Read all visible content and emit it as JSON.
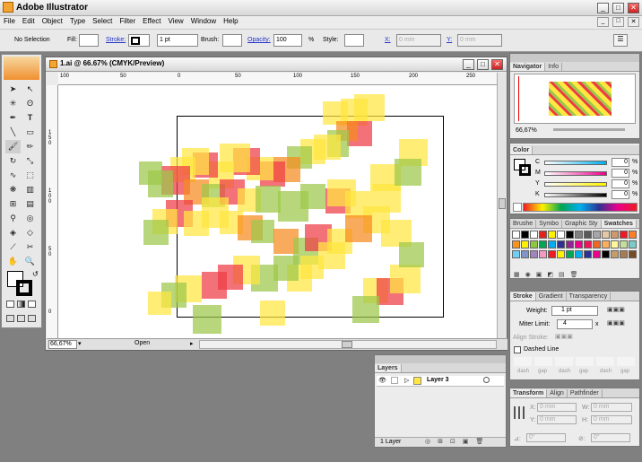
{
  "app": {
    "title": "Adobe Illustrator"
  },
  "menu": [
    "File",
    "Edit",
    "Object",
    "Type",
    "Select",
    "Filter",
    "Effect",
    "View",
    "Window",
    "Help"
  ],
  "control": {
    "selection": "No Selection",
    "fill_label": "Fill:",
    "stroke_label": "Stroke:",
    "stroke_weight": "1 pt",
    "brush_label": "Brush:",
    "opacity_label": "Opacity:",
    "opacity_value": "100",
    "opacity_unit": "%",
    "style_label": "Style:",
    "x_label": "X:",
    "x_value": "0 mm",
    "y_label": "Y:",
    "y_value": "0 mm"
  },
  "document": {
    "title": "1.ai @ 66.67% (CMYK/Preview)",
    "zoom": "66,67%",
    "status": "Open",
    "hruler": [
      "100",
      "50",
      "0",
      "50",
      "100",
      "150",
      "200",
      "250"
    ],
    "vruler": [
      "1\n5\n0",
      "1\n0\n0",
      "5\n0",
      "0"
    ]
  },
  "navigator": {
    "tabs": [
      "Navigator",
      "Info"
    ],
    "zoom": "66,67%"
  },
  "color": {
    "tab": "Color",
    "channels": [
      {
        "label": "C",
        "value": "0",
        "unit": "%"
      },
      {
        "label": "M",
        "value": "0",
        "unit": "%"
      },
      {
        "label": "Y",
        "value": "0",
        "unit": "%"
      },
      {
        "label": "K",
        "value": "0",
        "unit": "%"
      }
    ]
  },
  "swatches": {
    "tabs": [
      "Brushe",
      "Symbo",
      "Graphic Sty",
      "Swatches"
    ],
    "colors": [
      "#ffffff",
      "#000000",
      "#ffffff",
      "#e2231a",
      "#fff200",
      "#ffffff",
      "#000000",
      "#808080",
      "#595959",
      "#a6a6a6",
      "#e5c7a6",
      "#ce9a6a",
      "#ed1c24",
      "#ff7f27",
      "#f7941d",
      "#fff200",
      "#8dc63f",
      "#00a651",
      "#00aeef",
      "#2e3192",
      "#92278f",
      "#ec008c",
      "#ed145b",
      "#f26522",
      "#fbaf5d",
      "#fff799",
      "#c4df9b",
      "#7accc8",
      "#6dcff6",
      "#8393ca",
      "#a186be",
      "#f49ac2",
      "#ed1c24",
      "#fff200",
      "#00a651",
      "#00aeef",
      "#2e3192",
      "#ec008c",
      "#000000",
      "#c69c6d",
      "#a67c52",
      "#754c24"
    ]
  },
  "stroke": {
    "tabs": [
      "Stroke",
      "Gradient",
      "Transparency"
    ],
    "weight_label": "Weight:",
    "weight": "1 pt",
    "miter_label": "Miter Limit:",
    "miter": "4",
    "miter_unit": "x",
    "align_label": "Align Stroke:",
    "dashed_label": "Dashed Line",
    "dash_labels": [
      "dash",
      "gap",
      "dash",
      "gap",
      "dash",
      "gap"
    ]
  },
  "layers": {
    "tab": "Layers",
    "rows": [
      {
        "name": "Layer 3"
      }
    ],
    "count": "1 Layer"
  },
  "transform": {
    "tabs": [
      "Transform",
      "Align",
      "Pathfinder"
    ],
    "x_label": "X:",
    "x": "0 mm",
    "y_label": "Y:",
    "y": "0 mm",
    "w_label": "W:",
    "w": "0 mm",
    "h_label": "H:",
    "h": "0 mm",
    "rot": "0°",
    "shear": "0°"
  },
  "artwork": {
    "colors": {
      "red": "#ee3b45",
      "yellow": "#ffe640",
      "green": "#9cc84a",
      "orange": "#f68b1f"
    }
  }
}
